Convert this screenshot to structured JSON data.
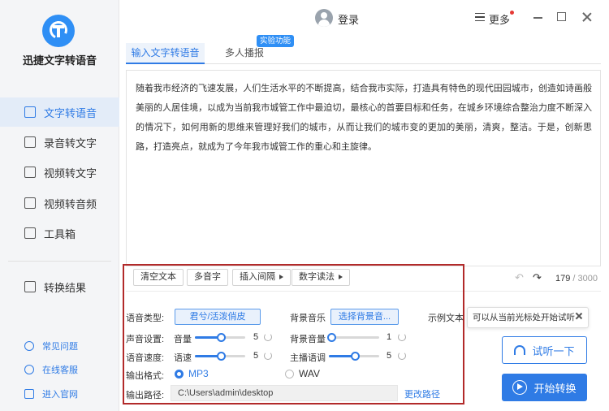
{
  "app": {
    "title": "迅捷文字转语音"
  },
  "sidebar": {
    "items": [
      {
        "label": "文字转语音",
        "icon": "text-to-speech-icon",
        "active": true
      },
      {
        "label": "录音转文字",
        "icon": "recording-icon"
      },
      {
        "label": "视频转文字",
        "icon": "video-text-icon"
      },
      {
        "label": "视频转音频",
        "icon": "video-audio-icon"
      },
      {
        "label": "工具箱",
        "icon": "toolbox-icon"
      }
    ],
    "results": {
      "label": "转换结果",
      "icon": "results-icon"
    },
    "footer": [
      {
        "label": "常见问题",
        "icon": "question-icon"
      },
      {
        "label": "在线客服",
        "icon": "headset-icon"
      },
      {
        "label": "进入官网",
        "icon": "monitor-icon"
      }
    ]
  },
  "header": {
    "login_label": "登录",
    "more_label": "更多"
  },
  "tabs": [
    {
      "label": "输入文字转语音",
      "active": true
    },
    {
      "label": "多人播报"
    }
  ],
  "experimental_badge": "实验功能",
  "editor": {
    "content": "随着我市经济的飞速发展，人们生活水平的不断提高，结合我市实际，打造具有特色的现代田园城市，创造如诗画般美丽的人居佳境，以成为当前我市城管工作中最迫切，最核心的首要目标和任务，在城乡环境综合整治力度不断深入的情况下，如何用新的思维来管理好我们的城市，从而让我们的城市变的更加的美丽，清爽，整洁。于是，创新思路，打造亮点，就成为了今年我市城管工作的重心和主旋律。",
    "char_count": "179",
    "char_max": "/ 3000"
  },
  "toolbar": {
    "clear": "清空文本",
    "polyphone": "多音字",
    "insert_pause": "插入间隔",
    "number_reading": "数字读法"
  },
  "settings": {
    "voice_type_label": "语音类型:",
    "voice_type_value": "君兮/活泼俏皮",
    "bgm_label": "背景音乐",
    "bgm_button": "选择背景音...",
    "sound_label": "声音设置:",
    "volume_label": "音量",
    "volume_value": "5",
    "volume_fraction": 0.52,
    "bgm_volume_label": "背景音量",
    "bgm_volume_value": "1",
    "bgm_volume_fraction": 0.05,
    "speed_section_label": "语音速度:",
    "speed_label": "语速",
    "speed_value": "5",
    "speed_fraction": 0.52,
    "pitch_label": "主播语调",
    "pitch_value": "5",
    "pitch_fraction": 0.52,
    "format_label": "输出格式:",
    "format_mp3": "MP3",
    "format_wav": "WAV",
    "format_selected": "MP3",
    "path_label": "输出路径:",
    "path_value": "C:\\Users\\admin\\desktop",
    "change_path": "更改路径"
  },
  "actions": {
    "example_label": "示例文本",
    "tooltip_text": "可以从当前光标处开始试听",
    "listen": "试听一下",
    "start": "开始转换"
  },
  "colors": {
    "accent": "#2f7be5",
    "highlight_border": "#b22a2a"
  }
}
